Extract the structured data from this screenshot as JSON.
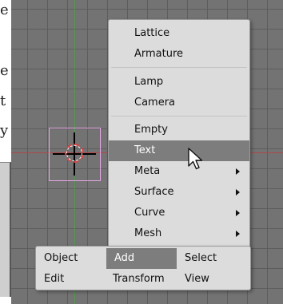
{
  "page_strip": {
    "chars": [
      "e",
      "e",
      "t",
      "y"
    ]
  },
  "menu": {
    "items": [
      {
        "label": "Lattice",
        "has_submenu": false,
        "highlighted": false
      },
      {
        "label": "Armature",
        "has_submenu": false,
        "highlighted": false
      },
      {
        "label": "Lamp",
        "has_submenu": false,
        "highlighted": false
      },
      {
        "label": "Camera",
        "has_submenu": false,
        "highlighted": false
      },
      {
        "label": "Empty",
        "has_submenu": false,
        "highlighted": false
      },
      {
        "label": "Text",
        "has_submenu": false,
        "highlighted": true
      },
      {
        "label": "Meta",
        "has_submenu": true,
        "highlighted": false
      },
      {
        "label": "Surface",
        "has_submenu": true,
        "highlighted": false
      },
      {
        "label": "Curve",
        "has_submenu": true,
        "highlighted": false
      },
      {
        "label": "Mesh",
        "has_submenu": true,
        "highlighted": false
      }
    ]
  },
  "toolbar": {
    "row1": [
      {
        "label": "Object",
        "highlighted": false
      },
      {
        "label": "Add",
        "highlighted": true
      },
      {
        "label": "Select",
        "highlighted": false
      }
    ],
    "row2": [
      {
        "label": "Edit",
        "highlighted": false
      },
      {
        "label": "Transform",
        "highlighted": false
      },
      {
        "label": "View",
        "highlighted": false
      }
    ]
  },
  "colors": {
    "viewport_bg": "#737373",
    "grid": "#5d5d5d",
    "menu_bg": "#dcdcdc",
    "highlight": "#7d7d7d",
    "x_axis": "#b04848",
    "y_axis": "#4f9a4f",
    "selection": "#e8a6e6"
  }
}
